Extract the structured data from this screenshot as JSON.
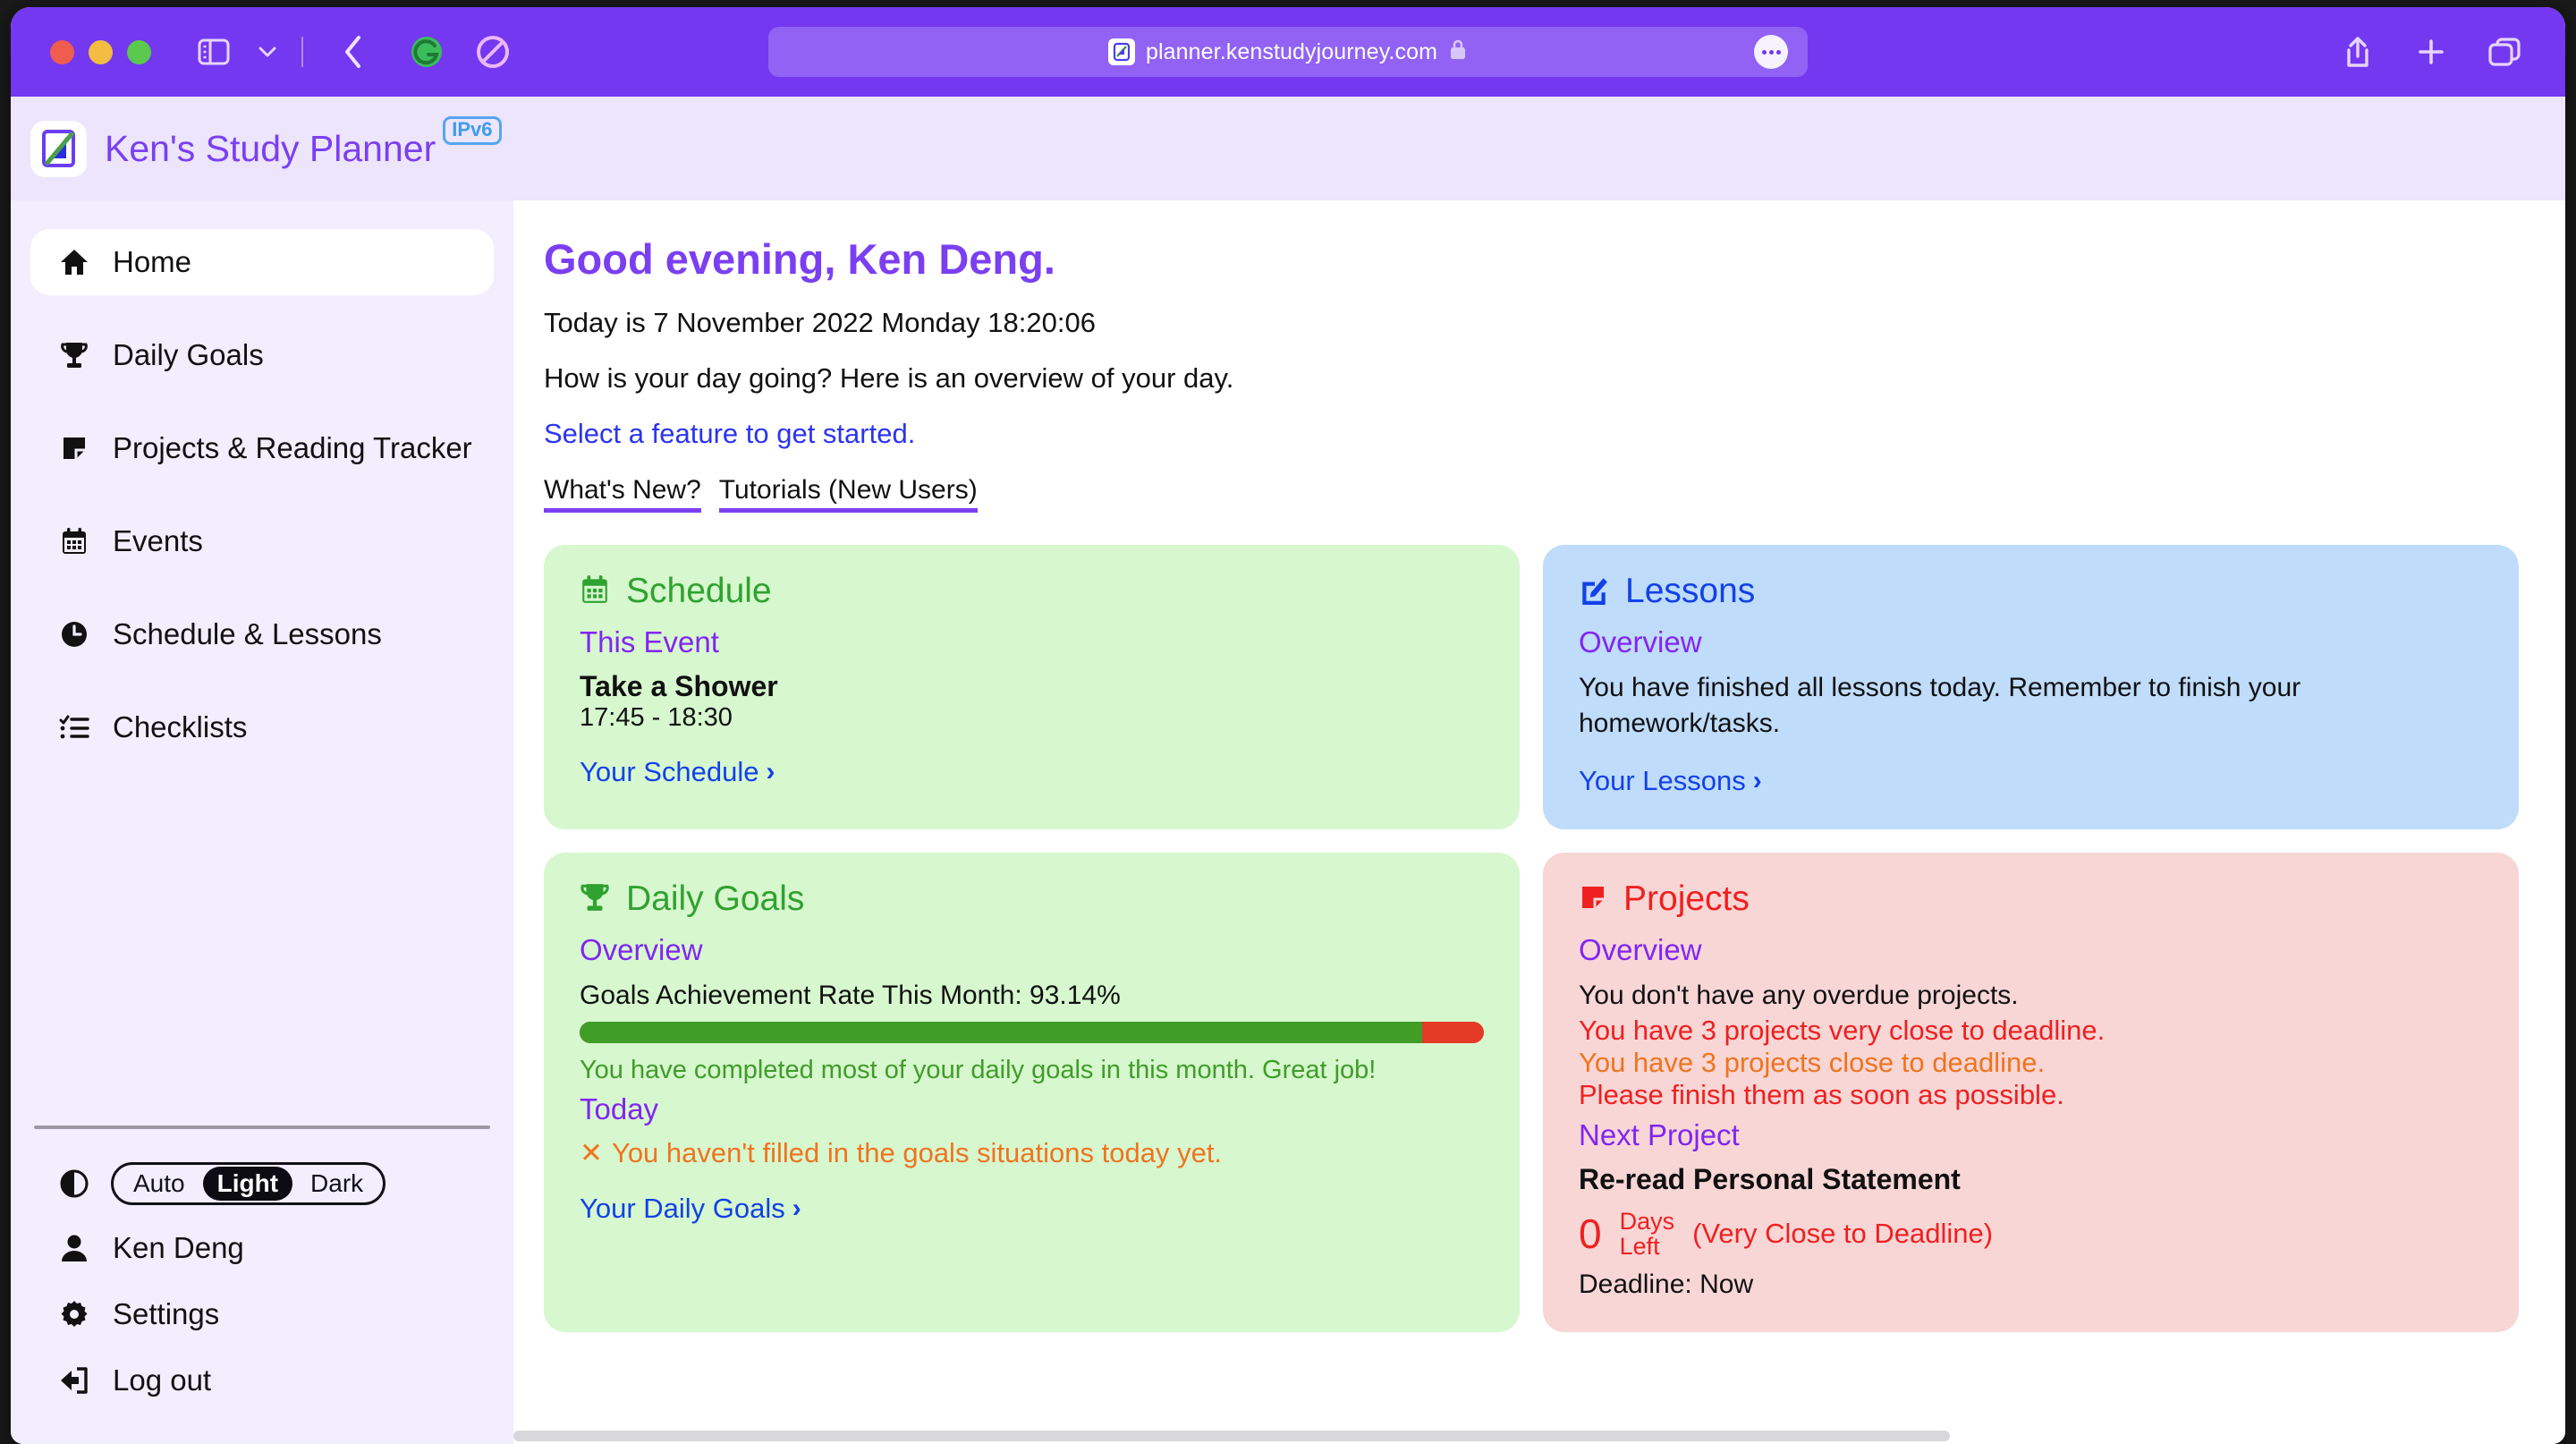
{
  "browser": {
    "url": "planner.kenstudyjourney.com",
    "lock_icon": "lock-icon",
    "favicon": "site-favicon",
    "buttons": {
      "sidebar_toggle": "sidebar-toggle-icon",
      "sidebar_dropdown": "chevron-down-icon",
      "back": "back-icon",
      "extension_grammarly": "grammarly-icon",
      "extension_adblock": "adblock-icon",
      "share": "share-icon",
      "new_tab": "plus-icon",
      "tabs": "tabs-icon",
      "more": "more-icon"
    }
  },
  "app": {
    "title": "Ken's Study Planner",
    "badge": "IPv6",
    "logo_icon": "app-logo-icon"
  },
  "sidebar": {
    "items": [
      {
        "label": "Home",
        "icon": "home-icon",
        "active": true
      },
      {
        "label": "Daily Goals",
        "icon": "trophy-icon",
        "active": false
      },
      {
        "label": "Projects & Reading Tracker",
        "icon": "note-icon",
        "active": false
      },
      {
        "label": "Events",
        "icon": "calendar-icon",
        "active": false
      },
      {
        "label": "Schedule & Lessons",
        "icon": "clock-icon",
        "active": false
      },
      {
        "label": "Checklists",
        "icon": "checklist-icon",
        "active": false
      }
    ],
    "theme": {
      "icon": "contrast-icon",
      "options": [
        "Auto",
        "Light",
        "Dark"
      ],
      "selected": "Light"
    },
    "account": {
      "label": "Ken Deng",
      "icon": "person-icon"
    },
    "settings": {
      "label": "Settings",
      "icon": "gear-icon"
    },
    "logout": {
      "label": "Log out",
      "icon": "logout-icon"
    }
  },
  "main": {
    "greeting": "Good evening, Ken Deng.",
    "today_line": "Today is 7 November 2022  Monday  18:20:06",
    "question_line": "How is your day going? Here is an overview of your day.",
    "select_feature": "Select a feature to get started.",
    "chips": [
      "What's New?",
      "Tutorials (New Users)"
    ]
  },
  "cards": {
    "schedule": {
      "title": "Schedule",
      "icon": "calendar-icon",
      "section": "This Event",
      "event_name": "Take a Shower",
      "event_time": "17:45 - 18:30",
      "link": "Your Schedule",
      "chevron": "›"
    },
    "lessons": {
      "title": "Lessons",
      "icon": "pencil-square-icon",
      "section": "Overview",
      "body": "You have finished all lessons today. Remember to finish your homework/tasks.",
      "link": "Your Lessons",
      "chevron": "›"
    },
    "daily_goals": {
      "title": "Daily Goals",
      "icon": "trophy-icon",
      "section": "Overview",
      "rate_label": "Goals Achievement Rate This Month: 93.14%",
      "rate_percent": 93.14,
      "progress_fill_color": "#3f9d28",
      "progress_rest_color": "#e33b25",
      "praise": "You have completed most of your daily goals in this month. Great job!",
      "today_heading": "Today",
      "today_status_icon": "✕",
      "today_status": "You haven't filled in the goals situations today yet.",
      "link": "Your Daily Goals",
      "chevron": "›"
    },
    "projects": {
      "title": "Projects",
      "icon": "note-icon",
      "section": "Overview",
      "no_overdue": "You don't have any overdue projects.",
      "very_close": "You have 3 projects very close to deadline.",
      "close": "You have 3 projects close to deadline.",
      "finish_soon": "Please finish them as soon as possible.",
      "next_heading": "Next Project",
      "next_name": "Re-read Personal Statement",
      "days_left_number": "0",
      "days_left_label": "Days\nLeft",
      "days_left_tag": "(Very Close to Deadline)",
      "deadline_partial": "Deadline: Now"
    }
  },
  "colors": {
    "browser_chrome": "#7438f0",
    "url_field": "#9162f4",
    "app_header": "#ece5fb",
    "sidebar_bg": "#f2eefd",
    "brand_purple": "#7b3ff2",
    "accent_purple": "#8126f0",
    "link_blue": "#1341e8",
    "card_green": "#d7f7cf",
    "card_blue": "#bfdcfb",
    "card_red": "#f8d6d6",
    "green_text": "#2fa22f",
    "blue_text": "#1341e8",
    "red_text": "#ef2020",
    "orange_text": "#f0741e"
  }
}
